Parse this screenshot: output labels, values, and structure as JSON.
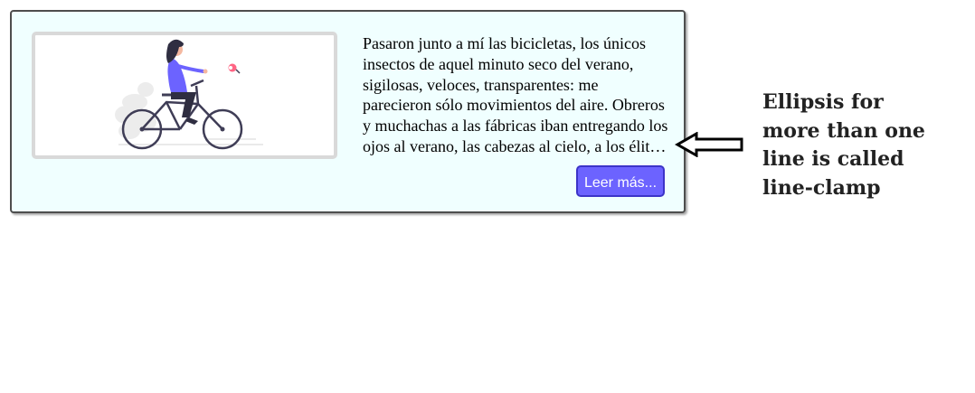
{
  "card": {
    "paragraph": "Pasaron junto a mí las bicicletas, los únicos insectos de aquel minuto seco del verano, sigilosas, veloces, transparentes: me parecieron sólo movimientos del aire. Obreros y muchachas a las fábricas iban entregando los ojos al verano, las cabezas al cielo, a los élitros duros del escarabajo.",
    "button_label": "Leer más...",
    "image": {
      "icon": "woman-cycling-illustration",
      "colors": {
        "accent": "#6c63ff",
        "hair": "#2f2e41",
        "flower": "#ff6584",
        "leaves": "#f2f2f2"
      }
    },
    "colors": {
      "background": "#f0ffff",
      "border": "#4e4e4e",
      "button": "#6c63ff"
    }
  },
  "annotation": {
    "text": "Ellipsis for\nmore than one\nline is called\nline-clamp"
  }
}
